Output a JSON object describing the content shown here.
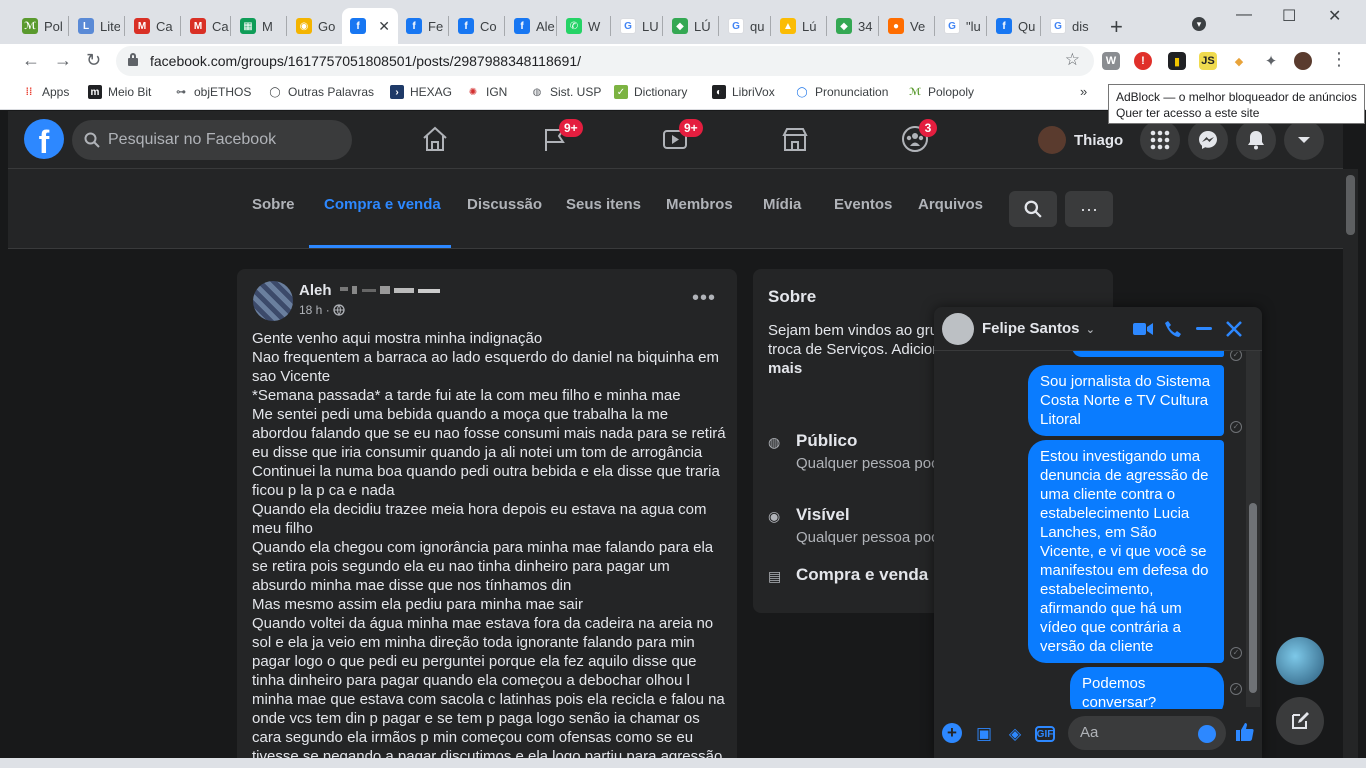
{
  "browser": {
    "tabs": [
      {
        "label": "Pol",
        "favicon": "polopoly-icon",
        "fav_color": "#5a9a2e",
        "fav_text": "ℳ"
      },
      {
        "label": "Lite",
        "favicon": "litera-icon",
        "fav_color": "#5a8ad6",
        "fav_text": "L"
      },
      {
        "label": "Ca",
        "favicon": "gmail-icon",
        "fav_color": "#d93025",
        "fav_text": "M"
      },
      {
        "label": "Ca",
        "favicon": "gmail-icon",
        "fav_color": "#d93025",
        "fav_text": "M"
      },
      {
        "label": "M",
        "favicon": "sheets-icon",
        "fav_color": "#0f9d58",
        "fav_text": "▦"
      },
      {
        "label": "Go",
        "favicon": "google-keep-icon",
        "fav_color": "#f4b400",
        "fav_text": "◉"
      },
      {
        "label": "",
        "favicon": "facebook-icon",
        "fav_color": "#1877f2",
        "fav_text": "f",
        "active": true
      },
      {
        "label": "Fe",
        "favicon": "facebook-icon",
        "fav_color": "#1877f2",
        "fav_text": "f"
      },
      {
        "label": "Co",
        "favicon": "facebook-icon",
        "fav_color": "#1877f2",
        "fav_text": "f"
      },
      {
        "label": "Ale",
        "favicon": "facebook-icon",
        "fav_color": "#1877f2",
        "fav_text": "f"
      },
      {
        "label": "W",
        "favicon": "whatsapp-icon",
        "fav_color": "#25d366",
        "fav_text": "✆"
      },
      {
        "label": "LU",
        "favicon": "google-icon",
        "fav_color": "#ffffff",
        "fav_text": "G"
      },
      {
        "label": "LÚ",
        "favicon": "maps-icon",
        "fav_color": "#34a853",
        "fav_text": "◆"
      },
      {
        "label": "qu",
        "favicon": "google-icon",
        "fav_color": "#ffffff",
        "fav_text": "G"
      },
      {
        "label": "Lú",
        "favicon": "drive-icon",
        "fav_color": "#fbbc04",
        "fav_text": "▲"
      },
      {
        "label": "34",
        "favicon": "maps-icon",
        "fav_color": "#34a853",
        "fav_text": "◆"
      },
      {
        "label": "Ve",
        "favicon": "orange-circle-icon",
        "fav_color": "#ff6d00",
        "fav_text": "●"
      },
      {
        "label": "\"lu",
        "favicon": "google-icon",
        "fav_color": "#ffffff",
        "fav_text": "G"
      },
      {
        "label": "Qu",
        "favicon": "facebook-icon",
        "fav_color": "#1877f2",
        "fav_text": "f"
      },
      {
        "label": "dis",
        "favicon": "google-icon",
        "fav_color": "#ffffff",
        "fav_text": "G"
      }
    ],
    "url": "facebook.com/groups/1617757051808501/posts/2987988348118691/",
    "bookmarks": [
      {
        "label": "Apps",
        "icon": "apps-grid-icon"
      },
      {
        "label": "Meio Bit",
        "icon": "meiobit-icon"
      },
      {
        "label": "objETHOS",
        "icon": "objethos-icon"
      },
      {
        "label": "Outras Palavras",
        "icon": "outras-palavras-icon"
      },
      {
        "label": "HEXAG",
        "icon": "hexag-icon"
      },
      {
        "label": "IGN",
        "icon": "ign-icon"
      },
      {
        "label": "Sist. USP",
        "icon": "globe-icon"
      },
      {
        "label": "Dictionary",
        "icon": "check-icon"
      },
      {
        "label": "LibriVox",
        "icon": "librivox-icon"
      },
      {
        "label": "Pronunciation",
        "icon": "pronunciation-icon"
      },
      {
        "label": "Polopoly",
        "icon": "polopoly-icon"
      }
    ],
    "tooltip": {
      "line1": "AdBlock — o melhor bloqueador de anúncios",
      "line2": "Quer ter acesso a este site"
    }
  },
  "facebook": {
    "search_placeholder": "Pesquisar no Facebook",
    "nav_badges": {
      "groups_manage": "9+",
      "watch": "9+",
      "groups": "3"
    },
    "profile_name": "Thiago",
    "group_tabs": [
      {
        "label": "Sobre"
      },
      {
        "label": "Compra e venda",
        "active": true
      },
      {
        "label": "Discussão"
      },
      {
        "label": "Seus itens"
      },
      {
        "label": "Membros"
      },
      {
        "label": "Mídia"
      },
      {
        "label": "Eventos"
      },
      {
        "label": "Arquivos"
      }
    ],
    "post": {
      "author": "Aleh",
      "meta": "18 h ·",
      "lines": [
        "Gente venho aqui mostra minha indignação",
        "Nao frequentem a barraca ao lado esquerdo do daniel na biquinha em sao Vicente",
        "*Semana passada* a tarde fui ate la com meu filho e minha mae",
        "Me sentei pedi uma bebida quando a moça que trabalha la me abordou falando que se eu nao fosse consumi mais nada para se retirá eu disse que iria consumir quando ja ali notei um tom de arrogância",
        "Continuei la numa boa quando pedi outra bebida e ela disse que traria ficou p la p ca e nada",
        "Quando ela decidiu trazee meia hora depois  eu estava na agua com meu filho",
        "Quando ela chegou com ignorância para minha mae falando para  ela se retira pois segundo ela eu nao tinha dinheiro  para pagar um absurdo minha mae disse que nos tínhamos din",
        "Mas mesmo assim ela pediu para minha mae sair",
        "Quando voltei da água minha mae estava fora da cadeira na areia no sol e ela ja veio em minha direção  toda ignorante falando para min pagar  logo o que pedi  eu perguntei porque ela fez aquilo disse que tinha dinheiro para pagar  quando ela começou a debochar olhou l minha mae que estava com sacola c latinhas pois ela recicla e falou na onde vcs tem din p pagar e se tem p paga logo senão ia chamar os cara segundo ela irmãos p min começou com ofensas como se eu tivesse se negando  a pagar discutimos e ela logo partiu para agressão"
      ]
    },
    "about": {
      "title": "Sobre",
      "description": "Sejam bem vindos ao gru criado para vendas, troca de Serviços. Adicione seus amigos, qu",
      "more": "mais",
      "rows": [
        {
          "title": "Público",
          "desc": "Qualquer pessoa poc grupo e o que public",
          "icon": "globe-icon"
        },
        {
          "title": "Visível",
          "desc": "Qualquer pessoa poc",
          "icon": "eye-icon"
        },
        {
          "title": "Compra e venda",
          "desc": "",
          "icon": "shop-icon"
        }
      ]
    },
    "chat": {
      "name": "Felipe Santos",
      "messages": [
        "Sou jornalista do Sistema Costa Norte e TV Cultura Litoral",
        "Estou investigando uma denuncia de agressão de uma cliente contra o estabelecimento Lucia Lanches, em São Vicente, e vi que você se manifestou em defesa do estabelecimento, afirmando que há um vídeo que contrária a versão da cliente",
        "Podemos conversar?"
      ],
      "input_placeholder": "Aa"
    }
  }
}
